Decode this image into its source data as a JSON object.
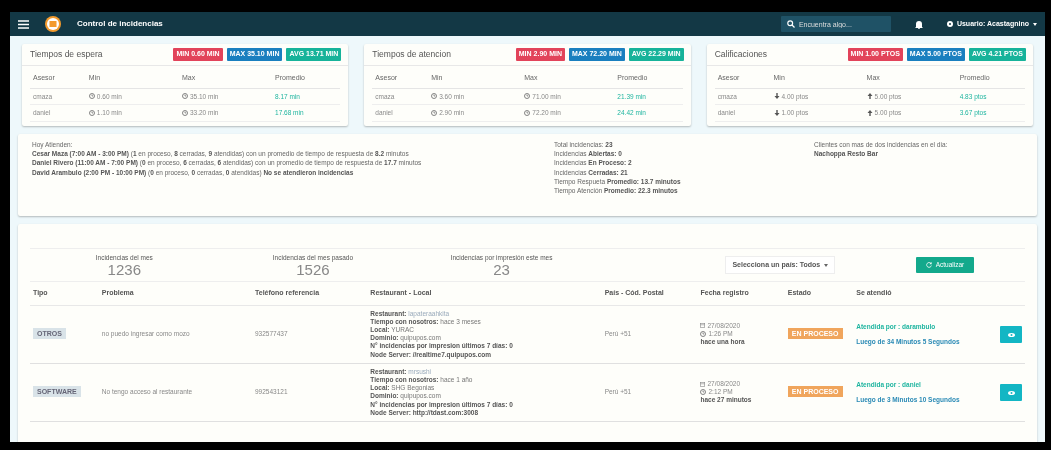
{
  "navbar": {
    "title": "Control de incidencias",
    "search": {
      "placeholder": "Encuentra algo..."
    },
    "user": "Usuario: Acastagnino"
  },
  "stat_cards": [
    {
      "title": "Tiempos de espera",
      "kind": "time",
      "badges": [
        {
          "kind": "min",
          "text": "MIN 0.60 MIN"
        },
        {
          "kind": "max",
          "text": "MAX 35.10 MIN"
        },
        {
          "kind": "avg",
          "text": "AVG 13.71 MIN"
        }
      ],
      "columns": [
        "Asesor",
        "Min",
        "Max",
        "Promedio"
      ],
      "rows": [
        {
          "asesor": "cmaza",
          "min": "0.60 min",
          "max": "35.10 min",
          "promedio": "8.17 min"
        },
        {
          "asesor": "daniel",
          "min": "1.10 min",
          "max": "33.20 min",
          "promedio": "17.68 min"
        }
      ]
    },
    {
      "title": "Tiempos de atencion",
      "kind": "time",
      "badges": [
        {
          "kind": "min",
          "text": "MIN 2.90 MIN"
        },
        {
          "kind": "max",
          "text": "MAX 72.20 MIN"
        },
        {
          "kind": "avg",
          "text": "AVG 22.29 MIN"
        }
      ],
      "columns": [
        "Asesor",
        "Min",
        "Max",
        "Promedio"
      ],
      "rows": [
        {
          "asesor": "cmaza",
          "min": "3.60 min",
          "max": "71.00 min",
          "promedio": "21.39 min"
        },
        {
          "asesor": "daniel",
          "min": "2.90 min",
          "max": "72.20 min",
          "promedio": "24.42 min"
        }
      ]
    },
    {
      "title": "Calificaciones",
      "kind": "score",
      "badges": [
        {
          "kind": "min",
          "text": "MIN 1.00 PTOS"
        },
        {
          "kind": "max",
          "text": "MAX 5.00 PTOS"
        },
        {
          "kind": "avg",
          "text": "AVG 4.21 PTOS"
        }
      ],
      "columns": [
        "Asesor",
        "Min",
        "Max",
        "Promedio"
      ],
      "rows": [
        {
          "asesor": "cmaza",
          "min": "4.00 ptos",
          "max": "5.00 ptos",
          "promedio": "4.83 ptos"
        },
        {
          "asesor": "daniel",
          "min": "1.00 ptos",
          "max": "5.00 ptos",
          "promedio": "3.67 ptos"
        }
      ]
    }
  ],
  "today": {
    "heading": "Hoy Atienden:",
    "lines": [
      "**Cesar Maza (7:00 AM - 3:00 PM)** (**1** en proceso, **8** cerradas, **9** atendidas) con un promedio de tiempo de respuesta de **8.2** minutos",
      "**Daniel Rivero (11:00 AM - 7:00 PM)** (**0** en proceso, **6** cerradas, **6** atendidas) con un promedio de tiempo de respuesta de **17.7** minutos",
      "**David Arambulo (2:00 PM - 10:00 PM)** (**0** en proceso, **0** cerradas, **0** atendidas) **No se atendieron incidencias**"
    ]
  },
  "totals": [
    "Total incidencias: **23**",
    "Incidencias **Abiertas: 0**",
    "Incidencias **En Proceso: 2**",
    "Incidencias **Cerradas: 21**",
    "Tiempo Respueta **Promedio: 13.7 minutos**",
    "Tiempo Atención **Promedio: 22.3 minutos**"
  ],
  "clients": {
    "heading": "Clientes con mas de dos incidencias en el dia:",
    "names": [
      "Nachoppa Resto Bar"
    ]
  },
  "counters": [
    {
      "label": "Incidencias del mes",
      "value": "1236"
    },
    {
      "label": "Incidencias del mes pasado",
      "value": "1526"
    },
    {
      "label": "Incidencias por impresión este mes",
      "value": "23"
    }
  ],
  "country_select": "Selecciona un país: Todos",
  "refresh_button": "Actualizar",
  "table": {
    "columns": [
      "Tipo",
      "Problema",
      "Teléfono referencia",
      "Restaurant - Local",
      "País - Cód. Postal",
      "Fecha registro",
      "Estado",
      "Se atendió"
    ],
    "rows": [
      {
        "tipo": "OTROS",
        "problema": "no puedo ingresar como mozo",
        "telefono": "932577437",
        "details": [
          {
            "label": "Restaurant:",
            "value": "lapateraahkita"
          },
          {
            "label": "Tiempo con nosotros:",
            "value": "hace 3 meses"
          },
          {
            "label": "Local:",
            "value": "YURAC"
          },
          {
            "label": "Dominio:",
            "value": "quipupos.com"
          },
          {
            "label": "N° incidencias por impresion últimos 7 días: 0"
          },
          {
            "label": "Node Server: //realtime7.quipupos.com"
          }
        ],
        "pais": "Perú +51",
        "fecha": "27/08/2020",
        "hora": "1:26 PM",
        "hace": "hace una hora",
        "estado": "EN PROCESO",
        "atendida": "Atendida por : darambulo",
        "luego": "Luego de 34 Minutos 5 Segundos"
      },
      {
        "tipo": "SOFTWARE",
        "problema": "No tengo acceso al restaurante",
        "telefono": "992543121",
        "details": [
          {
            "label": "Restaurant:",
            "value": "mrsushi"
          },
          {
            "label": "Tiempo con nosotros:",
            "value": "hace 1 año"
          },
          {
            "label": "Local:",
            "value": "SHG Begonias"
          },
          {
            "label": "Dominio:",
            "value": "quipupos.com"
          },
          {
            "label": "N° incidencias por impresion últimos 7 días: 0"
          },
          {
            "label": "Node Server: http://tdast.com:3008"
          }
        ],
        "pais": "Perú +51",
        "fecha": "27/08/2020",
        "hora": "2:12 PM",
        "hace": "hace 27 minutos",
        "estado": "EN PROCESO",
        "atendida": "Atendida por : daniel",
        "luego": "Luego de 3 Minutos 10 Segundos"
      }
    ]
  }
}
